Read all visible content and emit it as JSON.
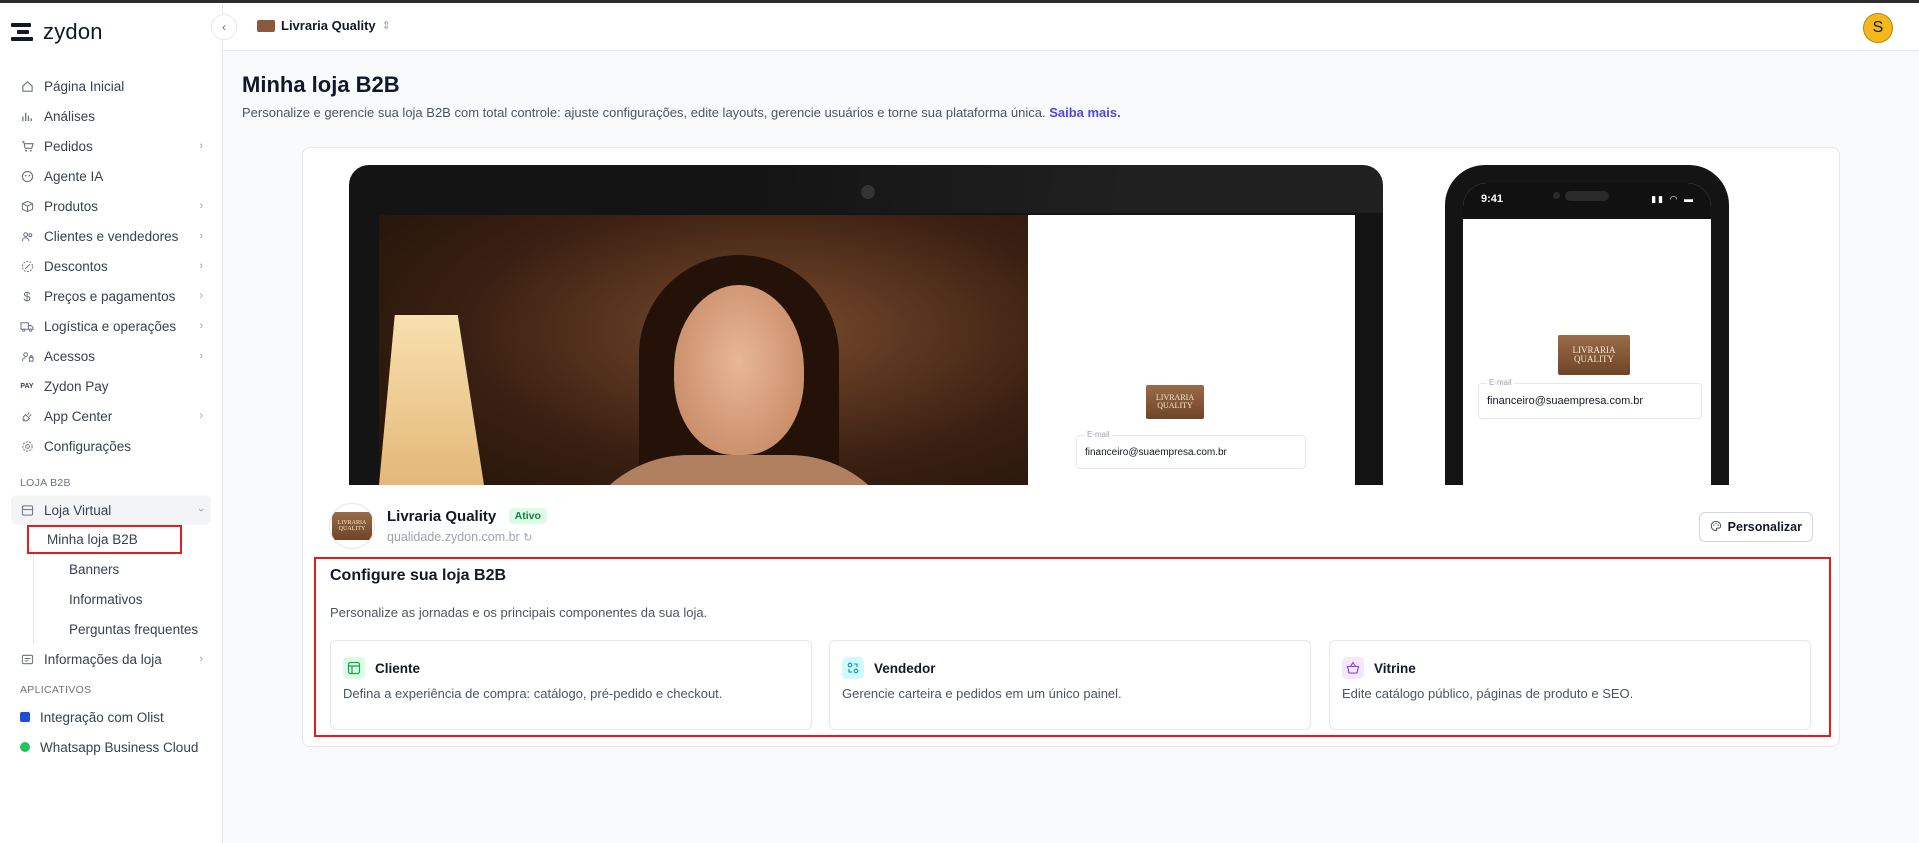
{
  "app": {
    "logo_text": "zydon"
  },
  "topbar": {
    "store_name": "Livraria Quality",
    "avatar_letter": "S"
  },
  "sidebar": {
    "items": [
      {
        "label": "Página Inicial",
        "icon": "home-icon"
      },
      {
        "label": "Análises",
        "icon": "chart-icon"
      },
      {
        "label": "Pedidos",
        "icon": "cart-icon",
        "has_children": true
      },
      {
        "label": "Agente IA",
        "icon": "ai-icon"
      },
      {
        "label": "Produtos",
        "icon": "box-icon",
        "has_children": true
      },
      {
        "label": "Clientes e vendedores",
        "icon": "users-icon",
        "has_children": true
      },
      {
        "label": "Descontos",
        "icon": "discount-icon",
        "has_children": true
      },
      {
        "label": "Preços e pagamentos",
        "icon": "dollar-icon",
        "has_children": true
      },
      {
        "label": "Logística e operações",
        "icon": "truck-icon",
        "has_children": true
      },
      {
        "label": "Acessos",
        "icon": "access-icon",
        "has_children": true
      },
      {
        "label": "Zydon Pay",
        "icon": "pay-icon"
      },
      {
        "label": "App Center",
        "icon": "plug-icon",
        "has_children": true
      },
      {
        "label": "Configurações",
        "icon": "gear-icon"
      }
    ],
    "section_store": "LOJA B2B",
    "store_group": {
      "label": "Loja Virtual",
      "children": [
        "Minha loja B2B",
        "Banners",
        "Informativos",
        "Perguntas frequentes"
      ]
    },
    "store_info": "Informações da loja",
    "section_apps": "APLICATIVOS",
    "apps": [
      {
        "label": "Integração com Olist",
        "color": "#1d4ed8"
      },
      {
        "label": "Whatsapp Business Cloud",
        "color": "#22c55e"
      }
    ]
  },
  "page": {
    "title": "Minha loja B2B",
    "subtitle": "Personalize e gerencie sua loja B2B com total controle: ajuste configurações, edite layouts, gerencie usuários e torne sua plataforma única.",
    "link": "Saiba mais."
  },
  "preview": {
    "logo_text": "LIVRARIA QUALITY",
    "email_label": "E-mail",
    "email_value": "financeiro@suaempresa.com.br",
    "phone_time": "9:41"
  },
  "store": {
    "name": "Livraria Quality",
    "status": "Ativo",
    "url": "qualidade.zydon.com.br",
    "personalize_label": "Personalizar"
  },
  "configure": {
    "title": "Configure sua loja B2B",
    "subtitle": "Personalize as jornadas e os principais componentes da sua loja.",
    "options": [
      {
        "title": "Cliente",
        "desc": "Defina a experiência de compra: catálogo, pré-pedido e checkout.",
        "color": "#16a34a"
      },
      {
        "title": "Vendedor",
        "desc": "Gerencie carteira e pedidos em um único painel.",
        "color": "#0891b2"
      },
      {
        "title": "Vitrine",
        "desc": "Edite catálogo público, páginas de produto e SEO.",
        "color": "#9333ea"
      }
    ]
  }
}
